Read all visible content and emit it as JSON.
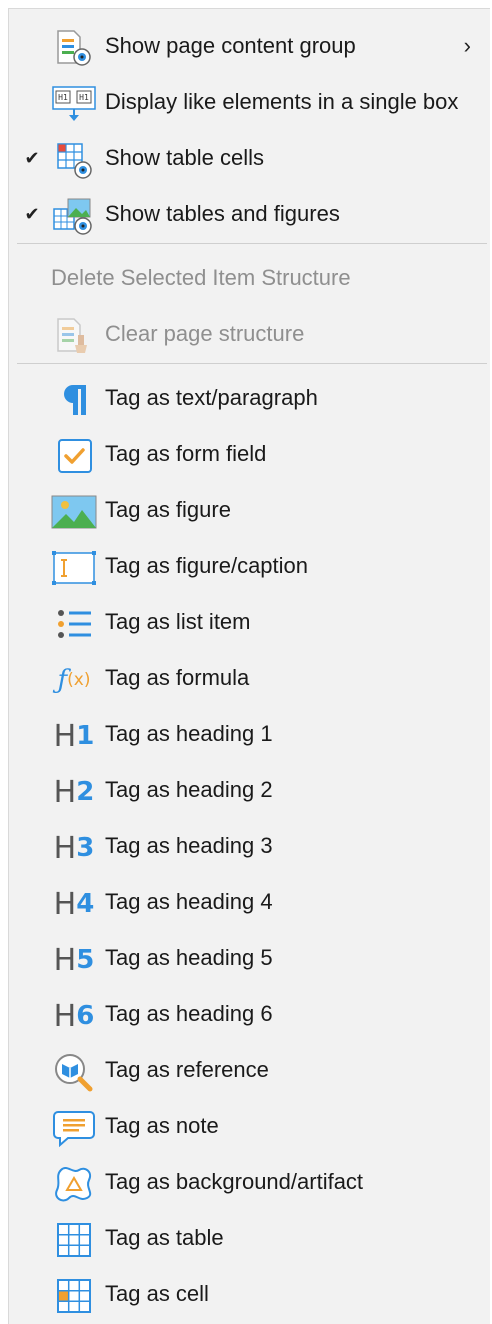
{
  "menu": {
    "group1": [
      {
        "label": "Show page content group",
        "icon": "page-content-group-icon",
        "checked": false,
        "submenu": true
      },
      {
        "label": "Display like elements in a single box",
        "icon": "single-box-icon",
        "checked": false,
        "submenu": false
      },
      {
        "label": "Show table cells",
        "icon": "table-cells-icon",
        "checked": true,
        "submenu": false
      },
      {
        "label": "Show tables and figures",
        "icon": "tables-figures-icon",
        "checked": true,
        "submenu": false
      }
    ],
    "group2": [
      {
        "label": "Delete Selected Item Structure",
        "disabled": true
      },
      {
        "label": "Clear page structure",
        "icon": "clear-structure-icon",
        "disabled": true
      }
    ],
    "group3": [
      {
        "label": "Tag as text/paragraph",
        "icon": "paragraph-icon"
      },
      {
        "label": "Tag as form field",
        "icon": "checkbox-icon"
      },
      {
        "label": "Tag as figure",
        "icon": "image-icon"
      },
      {
        "label": "Tag as figure/caption",
        "icon": "caption-icon"
      },
      {
        "label": "Tag as list item",
        "icon": "list-icon"
      },
      {
        "label": "Tag as formula",
        "icon": "formula-icon"
      },
      {
        "label": "Tag as heading 1",
        "icon": "heading-1-icon"
      },
      {
        "label": "Tag as heading 2",
        "icon": "heading-2-icon"
      },
      {
        "label": "Tag as heading 3",
        "icon": "heading-3-icon"
      },
      {
        "label": "Tag as heading 4",
        "icon": "heading-4-icon"
      },
      {
        "label": "Tag as heading 5",
        "icon": "heading-5-icon"
      },
      {
        "label": "Tag as heading 6",
        "icon": "heading-6-icon"
      },
      {
        "label": "Tag as reference",
        "icon": "reference-icon"
      },
      {
        "label": "Tag as note",
        "icon": "note-icon"
      },
      {
        "label": "Tag as background/artifact",
        "icon": "artifact-icon"
      },
      {
        "label": "Tag as table",
        "icon": "table-icon"
      },
      {
        "label": "Tag as cell",
        "icon": "cell-icon"
      }
    ],
    "check_glyph": "✔",
    "submenu_glyph": "›",
    "heading_glyphs": {
      "h": "H",
      "n1": "1",
      "n2": "2",
      "n3": "3",
      "n4": "4",
      "n5": "5",
      "n6": "6"
    },
    "formula_glyph": {
      "f": "ƒ",
      "x": "(x)"
    },
    "colors": {
      "accent": "#2f8fe0",
      "orange": "#f0a030",
      "text": "#1a1a1a",
      "disabled": "#8f8f8f",
      "background": "#f2f2f2"
    }
  }
}
